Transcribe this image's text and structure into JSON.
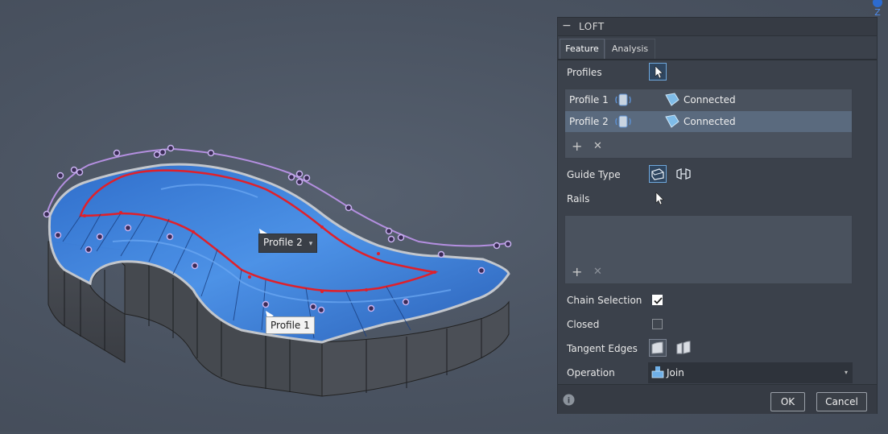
{
  "viewport": {
    "profile2_label": "Profile 2",
    "profile1_label": "Profile 1",
    "caret": "▾",
    "axis_label": "Z"
  },
  "panel": {
    "minimize_glyph": "−",
    "title": "LOFT",
    "tabs": [
      {
        "label": "Feature",
        "active": true
      },
      {
        "label": "Analysis",
        "active": false
      }
    ],
    "profiles_label": "Profiles",
    "profile_rows": [
      {
        "name": "Profile 1",
        "status": "Connected",
        "selected": false
      },
      {
        "name": "Profile 2",
        "status": "Connected",
        "selected": true
      }
    ],
    "add_glyph": "+",
    "remove_glyph": "✕",
    "guide_type_label": "Guide Type",
    "rails_label": "Rails",
    "chain_selection_label": "Chain Selection",
    "chain_selection_checked": true,
    "closed_label": "Closed",
    "closed_checked": false,
    "tangent_edges_label": "Tangent Edges",
    "operation_label": "Operation",
    "operation_value": "Join",
    "dropdown_caret": "▾",
    "info_glyph": "i",
    "ok_label": "OK",
    "cancel_label": "Cancel"
  },
  "colors": {
    "selection_blue": "#6fa8dc",
    "profile_red": "#e0202a",
    "surface_blue": "#3a7fd8",
    "guide_purple": "#b48fe0"
  }
}
